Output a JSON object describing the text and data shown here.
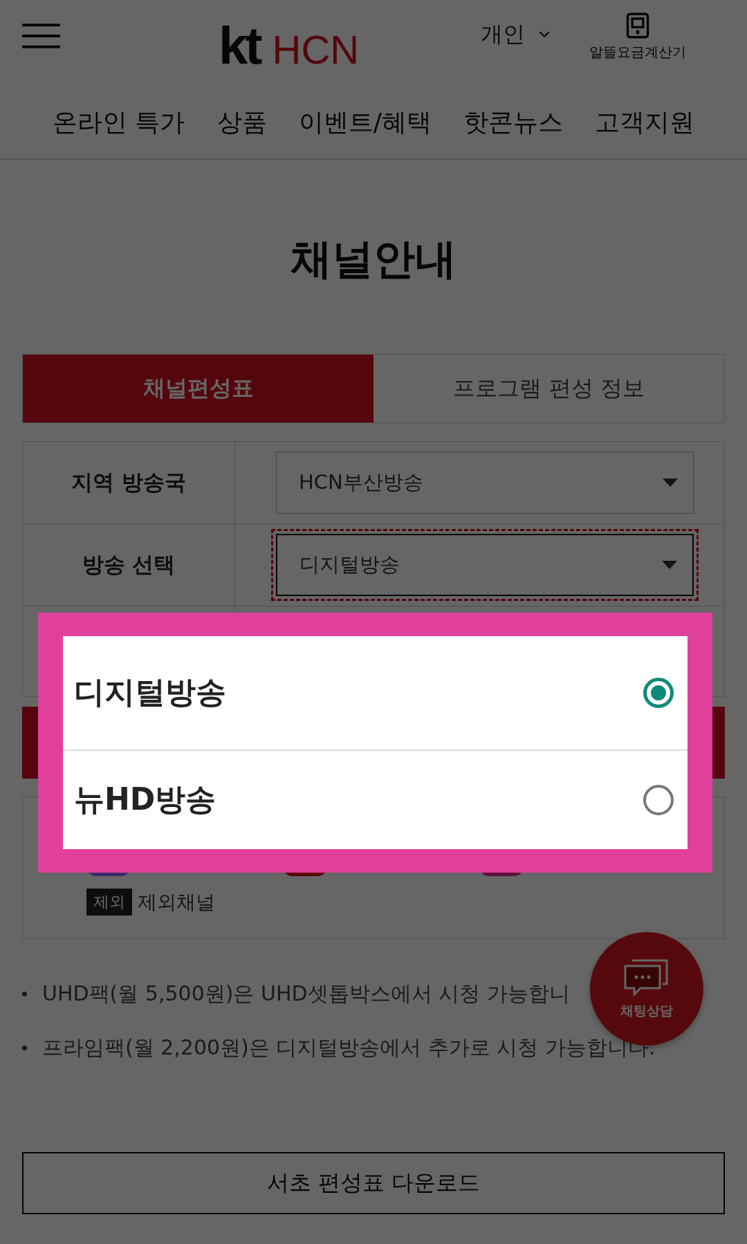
{
  "header": {
    "logo_mark": "kt",
    "logo_brand": "HCN",
    "account_type": "개인",
    "calculator_label": "알뜰요금계산기"
  },
  "nav": [
    "온라인 특가",
    "상품",
    "이벤트/혜택",
    "핫콘뉴스",
    "고객지원"
  ],
  "title": "채널안내",
  "tabs": [
    {
      "label": "채널편성표",
      "selected": true
    },
    {
      "label": "프로그램 편성 정보",
      "selected": false
    }
  ],
  "form_rows": [
    {
      "label": "지역 방송국",
      "value": "HCN부산방송",
      "focused": false
    },
    {
      "label": "방송 선택",
      "value": "디지털방송",
      "focused": true
    }
  ],
  "legend": [
    {
      "kind": "swatch",
      "color": "#3b2a6c"
    },
    {
      "kind": "swatch",
      "color": "#5a0008"
    },
    {
      "kind": "swatch",
      "color": "#5e0f3a"
    },
    {
      "kind": "tag",
      "badge": "제외",
      "label": "제외채널"
    }
  ],
  "notes": [
    "UHD팩(월 5,500원)은 UHD셋톱박스에서 시청 가능합니",
    "프라임팩(월 2,200원)은 디지털방송에서 추가로 시청 가능합니다."
  ],
  "download_button": "서초 편성표 다운로드",
  "chat_button": "채팅상담",
  "dialog": {
    "options": [
      {
        "label": "디지털방송",
        "selected": true
      },
      {
        "label": "뉴HD방송",
        "selected": false
      }
    ]
  }
}
